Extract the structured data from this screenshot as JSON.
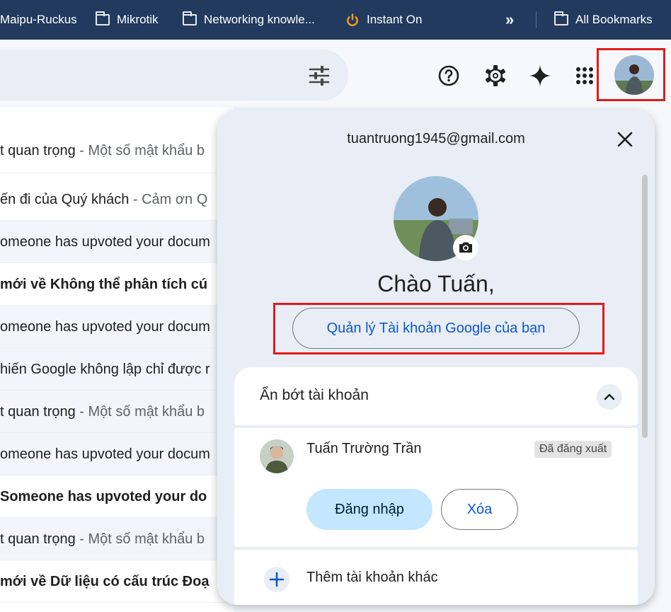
{
  "bookmarks": {
    "items": [
      "Maipu-Ruckus",
      "Mikrotik",
      "Networking knowle...",
      "Instant On",
      "All Bookmarks"
    ],
    "overflow": "»"
  },
  "header": {
    "icons": [
      "tune-icon",
      "help-icon",
      "settings-icon",
      "gemini-icon",
      "apps-icon"
    ]
  },
  "mails": [
    {
      "subject": "t quan trọng",
      "snippet": " - Một số mật khẩu b",
      "bold": false
    },
    {
      "subject": "ến đi của Quý khách",
      "snippet": " - Cảm ơn Q",
      "bold": false
    },
    {
      "subject": "omeone has upvoted your docum",
      "snippet": "",
      "bold": false
    },
    {
      "subject": " mới về Không thể phân tích cú",
      "snippet": "",
      "bold": true
    },
    {
      "subject": "omeone has upvoted your docum",
      "snippet": "",
      "bold": false
    },
    {
      "subject": "hiến Google không lập chỉ được r",
      "snippet": "",
      "bold": false
    },
    {
      "subject": "t quan trọng",
      "snippet": " - Một số mật khẩu b",
      "bold": false
    },
    {
      "subject": "omeone has upvoted your docum",
      "snippet": "",
      "bold": false
    },
    {
      "subject": " Someone has upvoted your do",
      "snippet": "",
      "bold": true
    },
    {
      "subject": "t quan trọng",
      "snippet": " - Một số mật khẩu b",
      "bold": false
    },
    {
      "subject": " mới về Dữ liệu có cấu trúc Đoạ",
      "snippet": "",
      "bold": true
    }
  ],
  "account_popup": {
    "email": "tuantruong1945@gmail.com",
    "greeting": "Chào Tuấn,",
    "manage_button": "Quản lý Tài khoản Google của bạn",
    "hide_accounts_label": "Ẩn bớt tài khoản",
    "other_account": {
      "name": "Tuấn Trường Trần",
      "status": "Đã đăng xuất",
      "signin_button": "Đăng nhập",
      "remove_button": "Xóa"
    },
    "add_account_label": "Thêm tài khoản khác"
  },
  "colors": {
    "bookmark_bar": "#223a5e",
    "highlight": "#e11a1a",
    "link_blue": "#0b57d0",
    "signin_bg": "#c2e7ff"
  }
}
